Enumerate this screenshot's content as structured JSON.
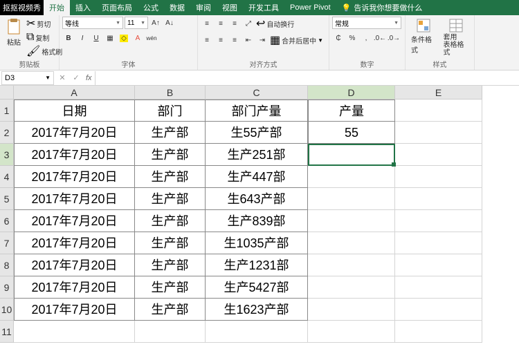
{
  "watermark": "抠抠视频秀",
  "tabs": {
    "home": "开始",
    "insert": "插入",
    "layout": "页面布局",
    "formulas": "公式",
    "data": "数据",
    "review": "审阅",
    "view": "视图",
    "dev": "开发工具",
    "pp": "Power Pivot"
  },
  "tellme": "告诉我你想要做什么",
  "clipboard": {
    "paste": "粘贴",
    "cut": "剪切",
    "copy": "复制",
    "painter": "格式刷",
    "label": "剪贴板"
  },
  "font": {
    "name": "等线",
    "size": "11",
    "label": "字体"
  },
  "align": {
    "wrap": "自动换行",
    "merge": "合并后居中",
    "label": "对齐方式"
  },
  "number": {
    "format": "常规",
    "label": "数字"
  },
  "styles": {
    "cf": "条件格式",
    "tf": "套用\n表格格式",
    "label": "样式"
  },
  "namebox": "D3",
  "cols": [
    "A",
    "B",
    "C",
    "D",
    "E"
  ],
  "rows": [
    "1",
    "2",
    "3",
    "4",
    "5",
    "6",
    "7",
    "8",
    "9",
    "10",
    "11"
  ],
  "grid": [
    [
      "日期",
      "部门",
      "部门产量",
      "产量",
      ""
    ],
    [
      "2017年7月20日",
      "生产部",
      "生55产部",
      "55",
      ""
    ],
    [
      "2017年7月20日",
      "生产部",
      "生产251部",
      "",
      ""
    ],
    [
      "2017年7月20日",
      "生产部",
      "生产447部",
      "",
      ""
    ],
    [
      "2017年7月20日",
      "生产部",
      "生643产部",
      "",
      ""
    ],
    [
      "2017年7月20日",
      "生产部",
      "生产839部",
      "",
      ""
    ],
    [
      "2017年7月20日",
      "生产部",
      "生1035产部",
      "",
      ""
    ],
    [
      "2017年7月20日",
      "生产部",
      "生产1231部",
      "",
      ""
    ],
    [
      "2017年7月20日",
      "生产部",
      "生产5427部",
      "",
      ""
    ],
    [
      "2017年7月20日",
      "生产部",
      "生1623产部",
      "",
      ""
    ],
    [
      "",
      "",
      "",
      "",
      ""
    ]
  ]
}
